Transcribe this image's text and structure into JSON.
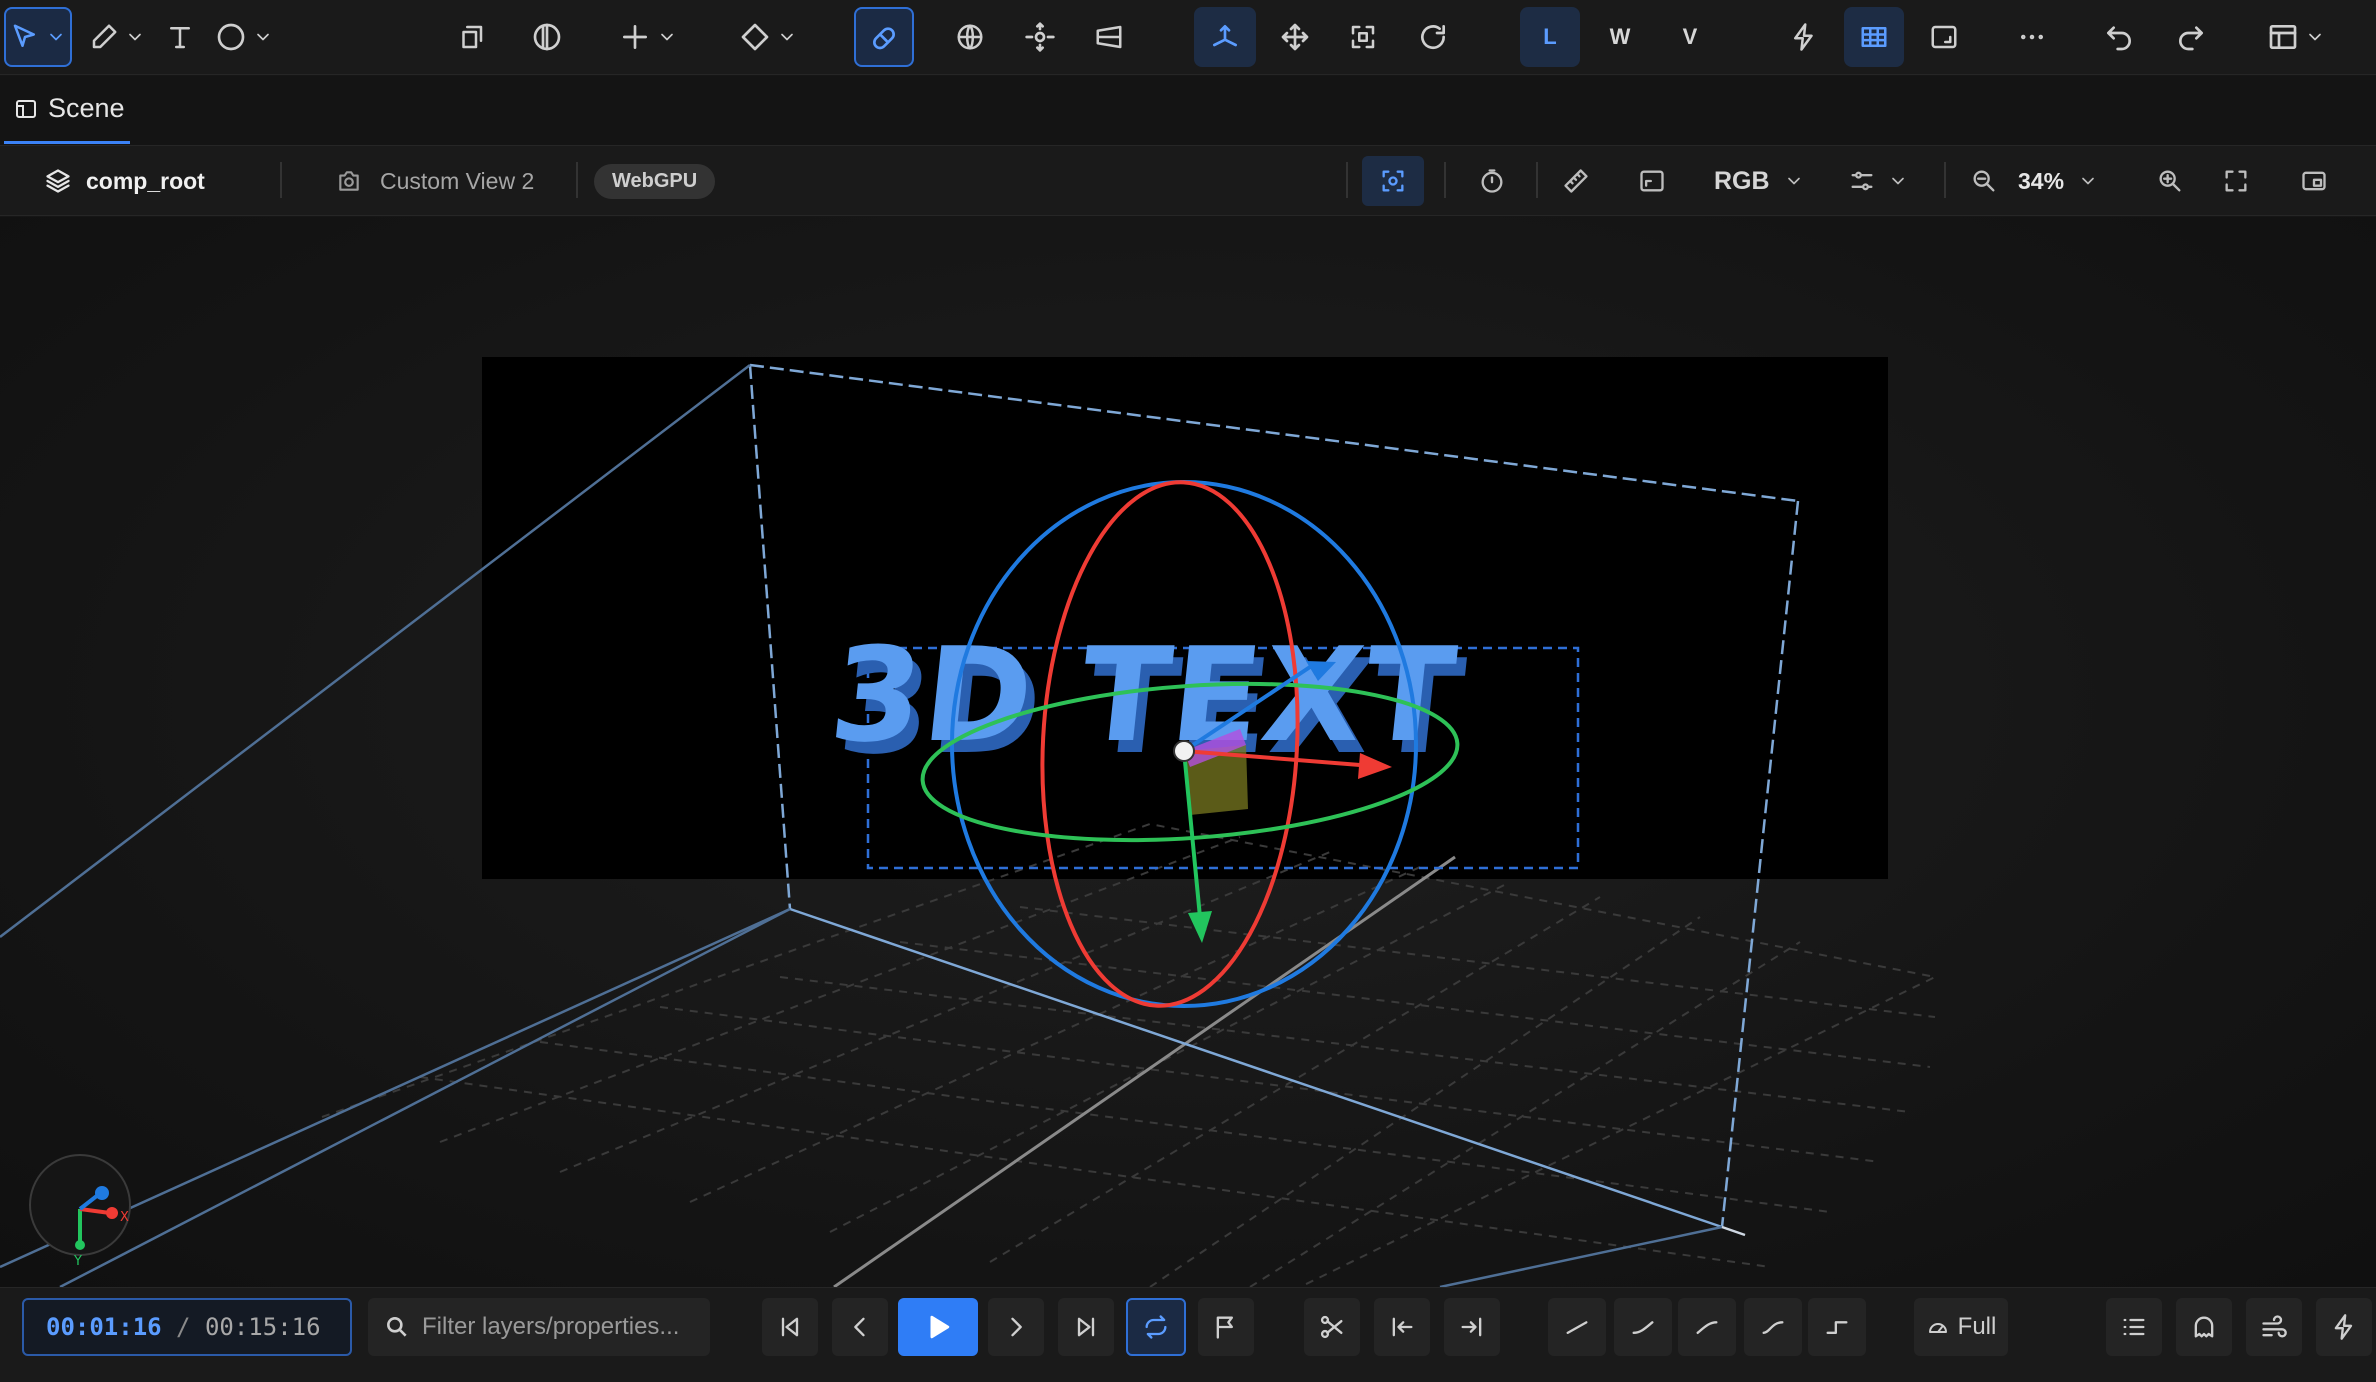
{
  "toolbar": {
    "tools": [
      {
        "id": "select",
        "icon": "cursor-arrow-icon",
        "has_menu": true,
        "active": true
      },
      {
        "id": "pen",
        "icon": "pen-icon",
        "has_menu": true
      },
      {
        "id": "text",
        "icon": "text-tool-icon",
        "has_menu": false
      },
      {
        "id": "shape",
        "icon": "ellipse-icon",
        "has_menu": true
      },
      {
        "id": "transform",
        "icon": "crop-icon",
        "has_menu": false
      },
      {
        "id": "mask",
        "icon": "mask-icon",
        "has_menu": false
      },
      {
        "id": "add",
        "icon": "plus-icon",
        "has_menu": true
      },
      {
        "id": "diamond",
        "icon": "diamond-icon",
        "has_menu": true
      },
      {
        "id": "snap",
        "icon": "magnet-icon",
        "has_menu": false,
        "active": true
      },
      {
        "id": "globe",
        "icon": "globe-icon"
      },
      {
        "id": "orbit",
        "icon": "orbit-icon"
      },
      {
        "id": "camera",
        "icon": "camera-plane-icon"
      },
      {
        "id": "move-axis",
        "icon": "axis-move-icon",
        "active": true
      },
      {
        "id": "move",
        "icon": "move-icon"
      },
      {
        "id": "scale",
        "icon": "scale-icon"
      },
      {
        "id": "rotate",
        "icon": "rotate-icon"
      }
    ],
    "space_modes": [
      "L",
      "W",
      "V"
    ],
    "active_space": "L",
    "right_tools": [
      "bolt-icon",
      "grid-icon",
      "frame-icon",
      "more-icon",
      "undo-icon",
      "redo-icon",
      "layout-icon"
    ]
  },
  "tabs": [
    {
      "label": "Scene",
      "active": true
    }
  ],
  "viewbar": {
    "composition": "comp_root",
    "view_name": "Custom View 2",
    "renderer_badge": "WebGPU",
    "channel": "RGB",
    "zoom": "34%"
  },
  "viewport": {
    "text_label": "3D TEXT",
    "axis_labels": {
      "x": "X",
      "y": "Y"
    },
    "colors": {
      "x_axis": "#ef3b34",
      "y_axis": "#22c55e",
      "z_axis": "#1f7ae0",
      "text": "#5a9cf0",
      "selection": "#3b82f6"
    }
  },
  "bottombar": {
    "current_time": "00:01:16",
    "separator": " / ",
    "total_time": "00:15:16",
    "filter_placeholder": "Filter layers/properties...",
    "playback": [
      "skip-start-icon",
      "prev-frame-icon",
      "play-icon",
      "next-frame-icon",
      "skip-end-icon",
      "loop-icon",
      "flag-icon"
    ],
    "edit": [
      "scissors-icon",
      "in-point-icon",
      "out-point-icon"
    ],
    "easing": [
      "linear-ease-icon",
      "ease-in-icon",
      "ease-out-icon",
      "ease-in-out-icon",
      "step-icon"
    ],
    "quality": "Full",
    "right": [
      "list-icon",
      "ghost-icon",
      "wind-icon",
      "bolt-icon"
    ]
  }
}
